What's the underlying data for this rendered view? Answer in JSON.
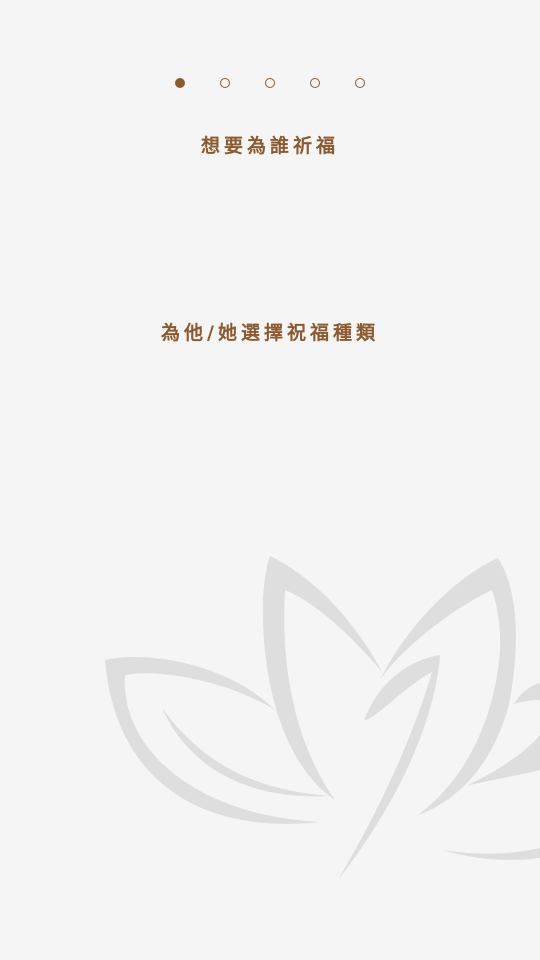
{
  "colors": {
    "accent": "#8b5a30",
    "background": "#f5f5f5",
    "watermark": "#dedede"
  },
  "stepper": {
    "total_steps": 5,
    "current_step": 1
  },
  "questions": {
    "who_label": "想要為誰祈福",
    "type_label": "為他/她選擇祝福種類"
  },
  "decoration": {
    "icon": "lotus-leaf-watermark-icon"
  }
}
